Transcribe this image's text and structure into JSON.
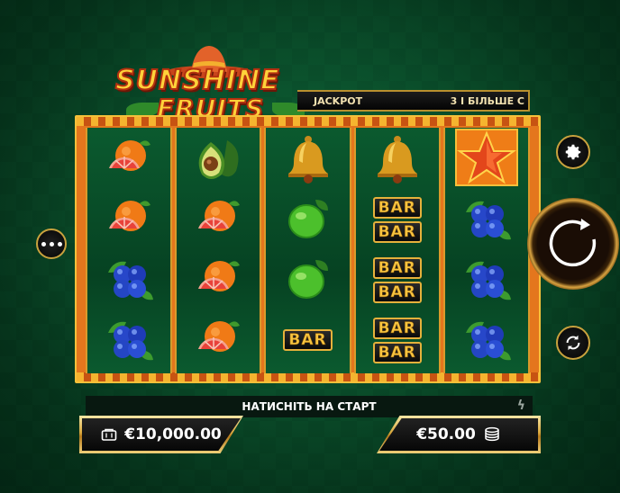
{
  "logo": {
    "line1": "SUNSHINE",
    "line2": "FRUITS"
  },
  "jackpot": {
    "left_text": "JACKPOT",
    "right_text": "3 І БІЛЬШЕ С"
  },
  "reels": [
    [
      "orange",
      "orange",
      "blueberries",
      "blueberries"
    ],
    [
      "avocado",
      "orange",
      "orange",
      "orange"
    ],
    [
      "bell",
      "lime",
      "lime",
      "bar"
    ],
    [
      "bell",
      "double-bar",
      "double-bar",
      "double-bar"
    ],
    [
      "star",
      "blueberries",
      "blueberries",
      "blueberries"
    ]
  ],
  "bar_label": "BAR",
  "message": "НАТИСНІТЬ НА СТАРТ",
  "balance": {
    "value": "€10,000.00",
    "icon": "wallet-icon"
  },
  "bet": {
    "value": "€50.00",
    "icon": "coins-icon"
  },
  "colors": {
    "gold": "#d9a83e",
    "felt": "#0a4d2a",
    "frame": "#e4761d"
  }
}
